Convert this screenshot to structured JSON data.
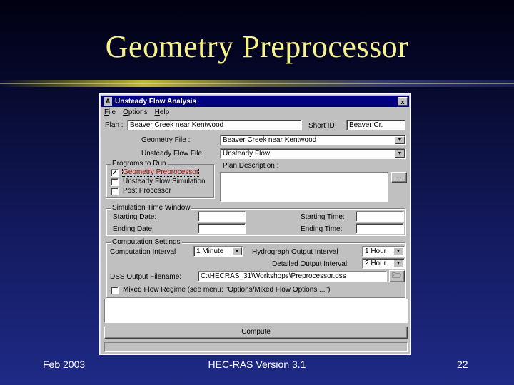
{
  "slide": {
    "title": "Geometry Preprocessor",
    "footer_left": "Feb 2003",
    "footer_center": "HEC-RAS Version 3.1",
    "footer_right": "22"
  },
  "window": {
    "title": "Unsteady Flow Analysis",
    "icon": "hec-ras-app-icon",
    "close": "x",
    "menu": [
      "File",
      "Options",
      "Help"
    ]
  },
  "plan": {
    "plan_label": "Plan :",
    "plan_value": "Beaver Creek near Kentwood",
    "short_id_label": "Short ID",
    "short_id_value": "Beaver Cr.",
    "geometry_label": "Geometry File :",
    "geometry_value": "Beaver Creek near Kentwood",
    "unsteady_label": "Unsteady Flow File",
    "unsteady_value": "Unsteady Flow",
    "description_label": "Plan Description :",
    "description_value": "",
    "description_button": "..."
  },
  "programs": {
    "group_label": "Programs to Run",
    "items": [
      {
        "label": "Geometry Preprocessor",
        "checked": true
      },
      {
        "label": "Unsteady Flow Simulation",
        "checked": false
      },
      {
        "label": "Post Processor",
        "checked": false
      }
    ]
  },
  "simulation": {
    "group_label": "Simulation Time Window",
    "starting_date_label": "Starting Date:",
    "starting_date_value": "",
    "ending_date_label": "Ending Date:",
    "ending_date_value": "",
    "starting_time_label": "Starting Time:",
    "starting_time_value": "",
    "ending_time_label": "Ending Time:",
    "ending_time_value": ""
  },
  "computation": {
    "group_label": "Computation Settings",
    "interval_label": "Computation Interval",
    "interval_value": "1 Minute",
    "hydrograph_label": "Hydrograph Output Interval",
    "hydrograph_value": "1 Hour",
    "detailed_label": "Detailed Output Interval:",
    "detailed_value": "2 Hour"
  },
  "dss": {
    "label": "DSS Output Filename:",
    "value": "C:\\HECRAS_31\\Workshops\\Preprocessor.dss",
    "mixed_flow_label": "Mixed Flow Regime (see menu: ''Options/Mixed Flow Options ...'')",
    "mixed_flow_checked": false
  },
  "compute_button": "Compute",
  "colors": {
    "title": "#f6f38a",
    "window_face": "#c0c0c0",
    "titlebar": "#000080"
  }
}
